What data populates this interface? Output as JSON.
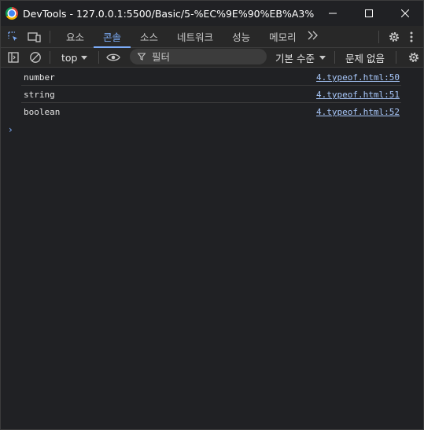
{
  "window": {
    "title": "DevTools - 127.0.0.1:5500/Basic/5-%EC%9E%90%EB%A3%8C%ED%..."
  },
  "tabs": [
    {
      "label": "요소",
      "active": false
    },
    {
      "label": "콘솔",
      "active": true
    },
    {
      "label": "소스",
      "active": false
    },
    {
      "label": "네트워크",
      "active": false
    },
    {
      "label": "성능",
      "active": false
    },
    {
      "label": "메모리",
      "active": false
    }
  ],
  "console_toolbar": {
    "context": "top",
    "filter_placeholder": "필터",
    "levels": "기본 수준",
    "issues": "문제 없음"
  },
  "messages": [
    {
      "text": "number",
      "source": "4.typeof.html:50"
    },
    {
      "text": "string",
      "source": "4.typeof.html:51"
    },
    {
      "text": "boolean",
      "source": "4.typeof.html:52"
    }
  ],
  "prompt": "›",
  "colors": {
    "accent": "#7cacf8",
    "link": "#a8c7fa",
    "background": "#202124"
  }
}
